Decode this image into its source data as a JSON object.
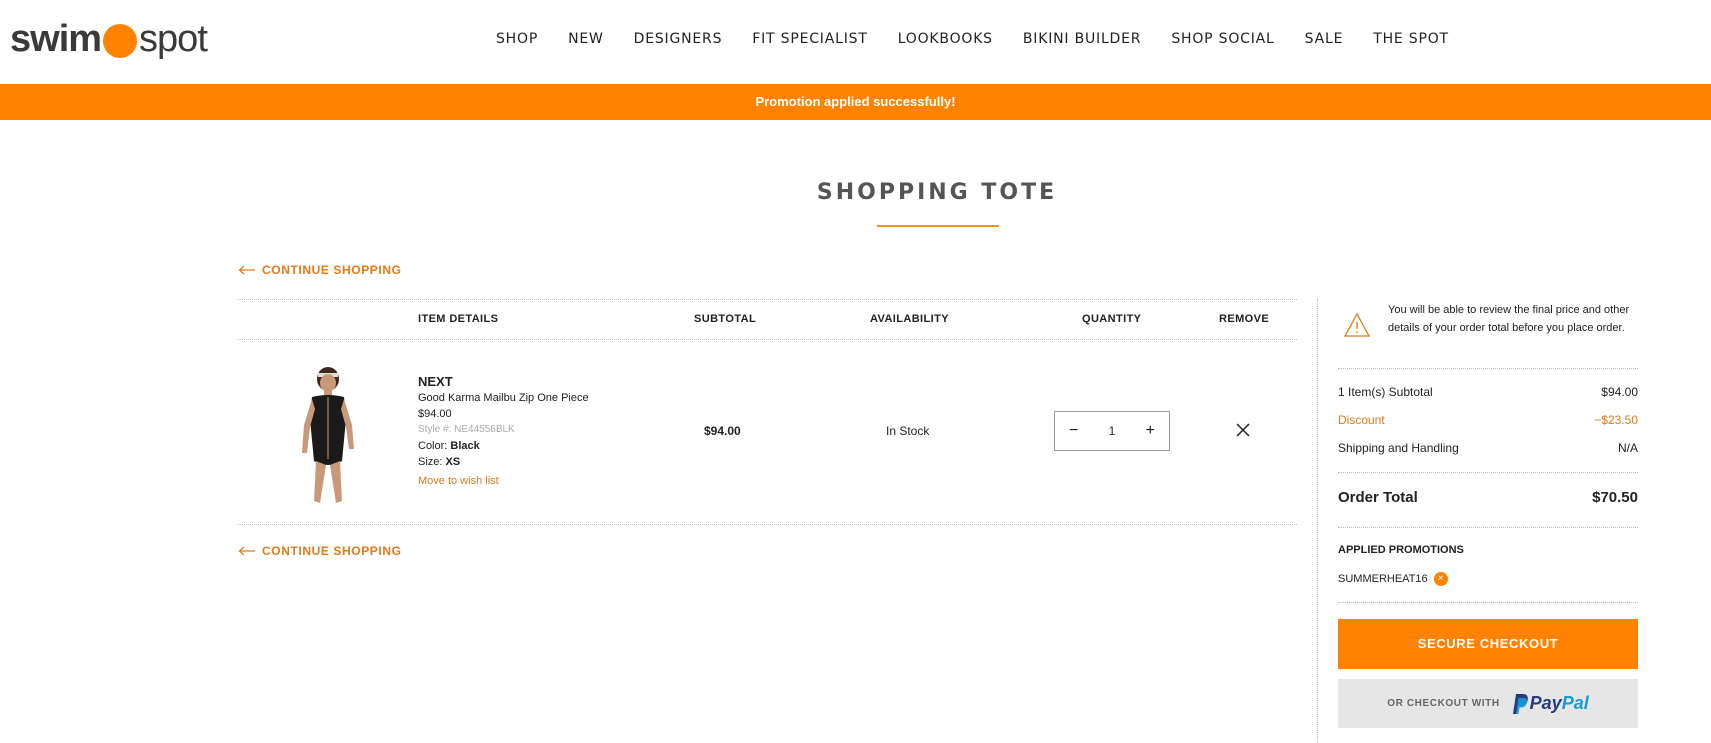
{
  "logo": {
    "part1": "swim",
    "part2": "spot"
  },
  "nav": [
    "SHOP",
    "NEW",
    "DESIGNERS",
    "FIT SPECIALIST",
    "LOOKBOOKS",
    "BIKINI BUILDER",
    "SHOP SOCIAL",
    "SALE",
    "THE SPOT"
  ],
  "promo_banner": "Promotion applied successfully!",
  "page_title": "SHOPPING TOTE",
  "continue_shopping": "CONTINUE SHOPPING",
  "table": {
    "headers": {
      "item_details": "ITEM DETAILS",
      "subtotal": "SUBTOTAL",
      "availability": "AVAILABILITY",
      "quantity": "QUANTITY",
      "remove": "REMOVE"
    },
    "item": {
      "brand": "NEXT",
      "name": "Good Karma Mailbu Zip One Piece",
      "price": "$94.00",
      "style": "Style #: NE44556BLK",
      "color_label": "Color:",
      "color": "Black",
      "size_label": "Size:",
      "size": "XS",
      "wish": "Move to wish list",
      "subtotal": "$94.00",
      "availability": "In Stock",
      "quantity": "1",
      "qty_minus": "−",
      "qty_plus": "+"
    }
  },
  "summary": {
    "notice": "You will be able to review the final price and other details of your order total before you place order.",
    "subtotal_label": "1 Item(s) Subtotal",
    "subtotal_value": "$94.00",
    "discount_label": "Discount",
    "discount_value": "−$23.50",
    "shipping_label": "Shipping and Handling",
    "shipping_value": "N/A",
    "total_label": "Order Total",
    "total_value": "$70.50",
    "promotions_heading": "APPLIED PROMOTIONS",
    "promo_code": "SUMMERHEAT16",
    "checkout_label": "SECURE CHECKOUT",
    "paypal_prefix": "OR CHECKOUT WITH",
    "paypal_pay": "Pay",
    "paypal_pal": "Pal"
  },
  "colors": {
    "accent": "#ff8200",
    "link": "#e07a1a"
  }
}
